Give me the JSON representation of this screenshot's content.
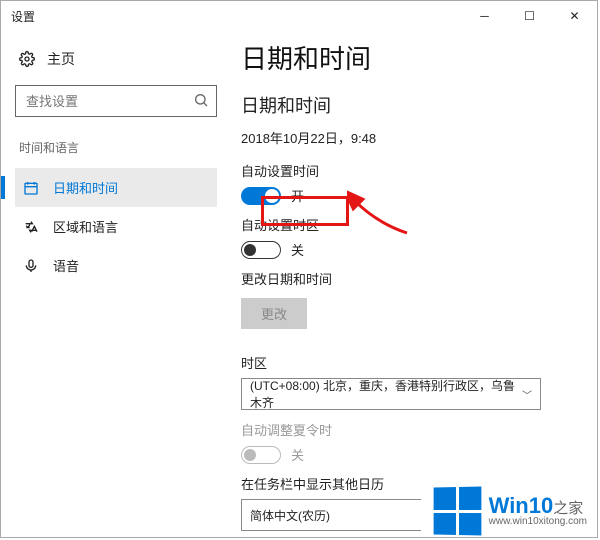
{
  "window": {
    "title": "设置"
  },
  "sidebar": {
    "home_label": "主页",
    "search_placeholder": "查找设置",
    "category": "时间和语言",
    "items": [
      {
        "label": "日期和时间",
        "icon": "clock-icon"
      },
      {
        "label": "区域和语言",
        "icon": "globe-icon"
      },
      {
        "label": "语音",
        "icon": "mic-icon"
      }
    ]
  },
  "main": {
    "title": "日期和时间",
    "section": "日期和时间",
    "current_datetime": "2018年10月22日，9:48",
    "auto_time_label": "自动设置时间",
    "auto_time_state": "开",
    "auto_tz_label": "自动设置时区",
    "auto_tz_state": "关",
    "change_label": "更改日期和时间",
    "change_button": "更改",
    "tz_label": "时区",
    "tz_value": "(UTC+08:00) 北京，重庆，香港特别行政区，乌鲁木齐",
    "dst_label": "自动调整夏令时",
    "dst_state": "关",
    "taskbar_label": "在任务栏中显示其他日历",
    "taskbar_value": "简体中文(农历)"
  },
  "branding": {
    "name": "Win10",
    "suffix": "之家",
    "url": "www.win10xitong.com"
  }
}
